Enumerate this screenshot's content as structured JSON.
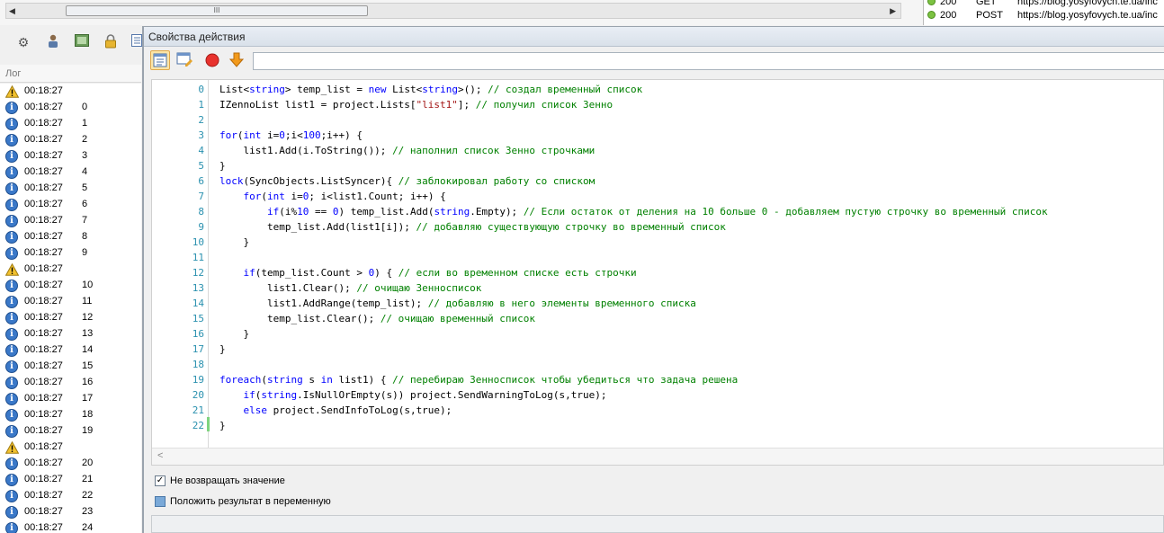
{
  "top": {
    "scroll_glyph": "III",
    "requests": [
      {
        "code": "200",
        "method": "GET",
        "url": "https://blog.yosyfovych.te.ua/inc"
      },
      {
        "code": "200",
        "method": "POST",
        "url": "https://blog.yosyfovych.te.ua/inc"
      }
    ]
  },
  "log": {
    "title": "Лог",
    "rows": [
      {
        "type": "warn",
        "time": "00:18:27",
        "msg": ""
      },
      {
        "type": "info",
        "time": "00:18:27",
        "msg": "0"
      },
      {
        "type": "info",
        "time": "00:18:27",
        "msg": "1"
      },
      {
        "type": "info",
        "time": "00:18:27",
        "msg": "2"
      },
      {
        "type": "info",
        "time": "00:18:27",
        "msg": "3"
      },
      {
        "type": "info",
        "time": "00:18:27",
        "msg": "4"
      },
      {
        "type": "info",
        "time": "00:18:27",
        "msg": "5"
      },
      {
        "type": "info",
        "time": "00:18:27",
        "msg": "6"
      },
      {
        "type": "info",
        "time": "00:18:27",
        "msg": "7"
      },
      {
        "type": "info",
        "time": "00:18:27",
        "msg": "8"
      },
      {
        "type": "info",
        "time": "00:18:27",
        "msg": "9"
      },
      {
        "type": "warn",
        "time": "00:18:27",
        "msg": ""
      },
      {
        "type": "info",
        "time": "00:18:27",
        "msg": "10"
      },
      {
        "type": "info",
        "time": "00:18:27",
        "msg": "11"
      },
      {
        "type": "info",
        "time": "00:18:27",
        "msg": "12"
      },
      {
        "type": "info",
        "time": "00:18:27",
        "msg": "13"
      },
      {
        "type": "info",
        "time": "00:18:27",
        "msg": "14"
      },
      {
        "type": "info",
        "time": "00:18:27",
        "msg": "15"
      },
      {
        "type": "info",
        "time": "00:18:27",
        "msg": "16"
      },
      {
        "type": "info",
        "time": "00:18:27",
        "msg": "17"
      },
      {
        "type": "info",
        "time": "00:18:27",
        "msg": "18"
      },
      {
        "type": "info",
        "time": "00:18:27",
        "msg": "19"
      },
      {
        "type": "warn",
        "time": "00:18:27",
        "msg": ""
      },
      {
        "type": "info",
        "time": "00:18:27",
        "msg": "20"
      },
      {
        "type": "info",
        "time": "00:18:27",
        "msg": "21"
      },
      {
        "type": "info",
        "time": "00:18:27",
        "msg": "22"
      },
      {
        "type": "info",
        "time": "00:18:27",
        "msg": "23"
      },
      {
        "type": "info",
        "time": "00:18:27",
        "msg": "24"
      }
    ]
  },
  "dialog": {
    "title": "Свойства действия",
    "input_value": "",
    "code_lines": [
      {
        "n": "0",
        "text": "List<string> temp_list = new List<string>(); // создал временный список"
      },
      {
        "n": "1",
        "text": "IZennoList list1 = project.Lists[\"list1\"]; // получил список Зенно"
      },
      {
        "n": "2",
        "text": ""
      },
      {
        "n": "3",
        "text": "for(int i=0;i<100;i++) {"
      },
      {
        "n": "4",
        "text": "    list1.Add(i.ToString()); // наполнил список Зенно строчками"
      },
      {
        "n": "5",
        "text": "}"
      },
      {
        "n": "6",
        "text": "lock(SyncObjects.ListSyncer){ // заблокировал работу со списком"
      },
      {
        "n": "7",
        "text": "    for(int i=0; i<list1.Count; i++) {"
      },
      {
        "n": "8",
        "text": "        if(i%10 == 0) temp_list.Add(string.Empty); // Если остаток от деления на 10 больше 0 - добавляем пустую строчку во временный список"
      },
      {
        "n": "9",
        "text": "        temp_list.Add(list1[i]); // добавляю существующую строчку во временный список"
      },
      {
        "n": "10",
        "text": "    }"
      },
      {
        "n": "11",
        "text": ""
      },
      {
        "n": "12",
        "text": "    if(temp_list.Count > 0) { // если во временном списке есть строчки"
      },
      {
        "n": "13",
        "text": "        list1.Clear(); // очищаю Зенносписок"
      },
      {
        "n": "14",
        "text": "        list1.AddRange(temp_list); // добавляю в него элементы временного списка"
      },
      {
        "n": "15",
        "text": "        temp_list.Clear(); // очищаю временный список"
      },
      {
        "n": "16",
        "text": "    }"
      },
      {
        "n": "17",
        "text": "}"
      },
      {
        "n": "18",
        "text": ""
      },
      {
        "n": "19",
        "text": "foreach(string s in list1) { // перебираю Зенносписок чтобы убедиться что задача решена"
      },
      {
        "n": "20",
        "text": "    if(string.IsNullOrEmpty(s)) project.SendWarningToLog(s,true);"
      },
      {
        "n": "21",
        "text": "    else project.SendInfoToLog(s,true);"
      },
      {
        "n": "22",
        "text": "}"
      }
    ],
    "scroll_left_glyph": "<",
    "option_return": {
      "label": "Не возвращать значение",
      "checked": true
    },
    "option_variable": {
      "label": "Положить результат в переменную",
      "checked": false
    }
  },
  "colors": {
    "keyword": "#0000ff",
    "comment": "#008000",
    "string": "#a31515",
    "number": "#0000ff",
    "line_number": "#2b91af",
    "warn": "#f2c12e",
    "info": "#3a78c8"
  }
}
